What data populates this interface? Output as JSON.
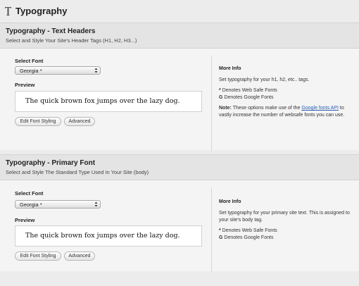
{
  "page": {
    "title": "Typography"
  },
  "sections": [
    {
      "title": "Typography - Text Headers",
      "description": "Select and Style Your Site's Header Tags (H1, H2, H3...)",
      "select_label": "Select Font",
      "select_value": "Georgia *",
      "preview_label": "Preview",
      "preview_text": "The quick brown fox jumps over the lazy dog.",
      "edit_button": "Edit Font Styling",
      "advanced_button": "Advanced",
      "info": {
        "title": "More Info",
        "text": "Set typography for your h1, h2, etc.. tags.",
        "legend_websafe_mark": "*",
        "legend_websafe_text": " Denotes Web Safe Fonts",
        "legend_google_mark": "G",
        "legend_google_text": " Denotes Google Fonts",
        "note_label": "Note:",
        "note_text_before": " These options make use of the ",
        "note_link": "Google fonts API",
        "note_text_after": " to vastly increase the number of websafe fonts you can use."
      }
    },
    {
      "title": "Typography - Primary Font",
      "description": "Select and Style The Standard Type Used In Your Site (body)",
      "select_label": "Select Font",
      "select_value": "Georgia *",
      "preview_label": "Preview",
      "preview_text": "The quick brown fox jumps over the lazy dog.",
      "edit_button": "Edit Font Styling",
      "advanced_button": "Advanced",
      "info": {
        "title": "More Info",
        "text": "Set typography for your primary site text. This is assigned to your site's body tag.",
        "legend_websafe_mark": "*",
        "legend_websafe_text": " Denotes Web Safe Fonts",
        "legend_google_mark": "G",
        "legend_google_text": " Denotes Google Fonts"
      }
    }
  ]
}
